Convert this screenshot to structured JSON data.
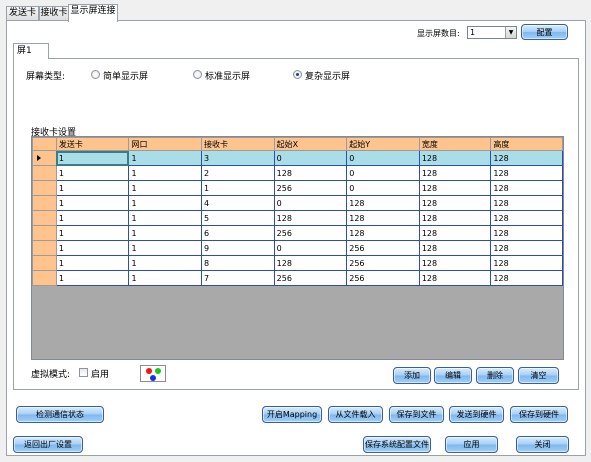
{
  "tabs": [
    "发送卡",
    "接收卡",
    "显示屏连接"
  ],
  "screen_count": {
    "label": "显示屏数目:",
    "value": "1"
  },
  "config_button": "配置",
  "inner_tab": "屏1",
  "screen_type": {
    "label": "屏幕类型:",
    "options": [
      "简单显示屏",
      "标准显示屏",
      "复杂显示屏"
    ],
    "selected": "复杂显示屏"
  },
  "receiver_settings_label": "接收卡设置",
  "table": {
    "columns": [
      "发送卡",
      "网口",
      "接收卡",
      "起始X",
      "起始Y",
      "宽度",
      "高度"
    ],
    "rows": [
      [
        "1",
        "1",
        "3",
        "0",
        "0",
        "128",
        "128"
      ],
      [
        "1",
        "1",
        "2",
        "128",
        "0",
        "128",
        "128"
      ],
      [
        "1",
        "1",
        "1",
        "256",
        "0",
        "128",
        "128"
      ],
      [
        "1",
        "1",
        "4",
        "0",
        "128",
        "128",
        "128"
      ],
      [
        "1",
        "1",
        "5",
        "128",
        "128",
        "128",
        "128"
      ],
      [
        "1",
        "1",
        "6",
        "256",
        "128",
        "128",
        "128"
      ],
      [
        "1",
        "1",
        "9",
        "0",
        "256",
        "128",
        "128"
      ],
      [
        "1",
        "1",
        "8",
        "128",
        "256",
        "128",
        "128"
      ],
      [
        "1",
        "1",
        "7",
        "256",
        "256",
        "128",
        "128"
      ]
    ]
  },
  "virtual_mode": {
    "label": "虚拟模式:",
    "enable_label": "启用"
  },
  "grid_buttons": [
    "添加",
    "编辑",
    "删除",
    "清空"
  ],
  "bottom_buttons": {
    "detect": "检测通信状态",
    "enable_mapping": "开启Mapping",
    "load_file": "从文件载入",
    "save_file": "保存到文件",
    "send_hw": "发送到硬件",
    "save_hw": "保存到硬件",
    "restore": "返回出厂设置",
    "save_sys": "保存系统配置文件",
    "apply": "应用",
    "close": "关闭"
  },
  "colors": {
    "header": "#ffc48e",
    "selected_row": "#a9dde8",
    "grid_bg": "#a9a9a9",
    "cell_border": "#2f4ea9"
  }
}
